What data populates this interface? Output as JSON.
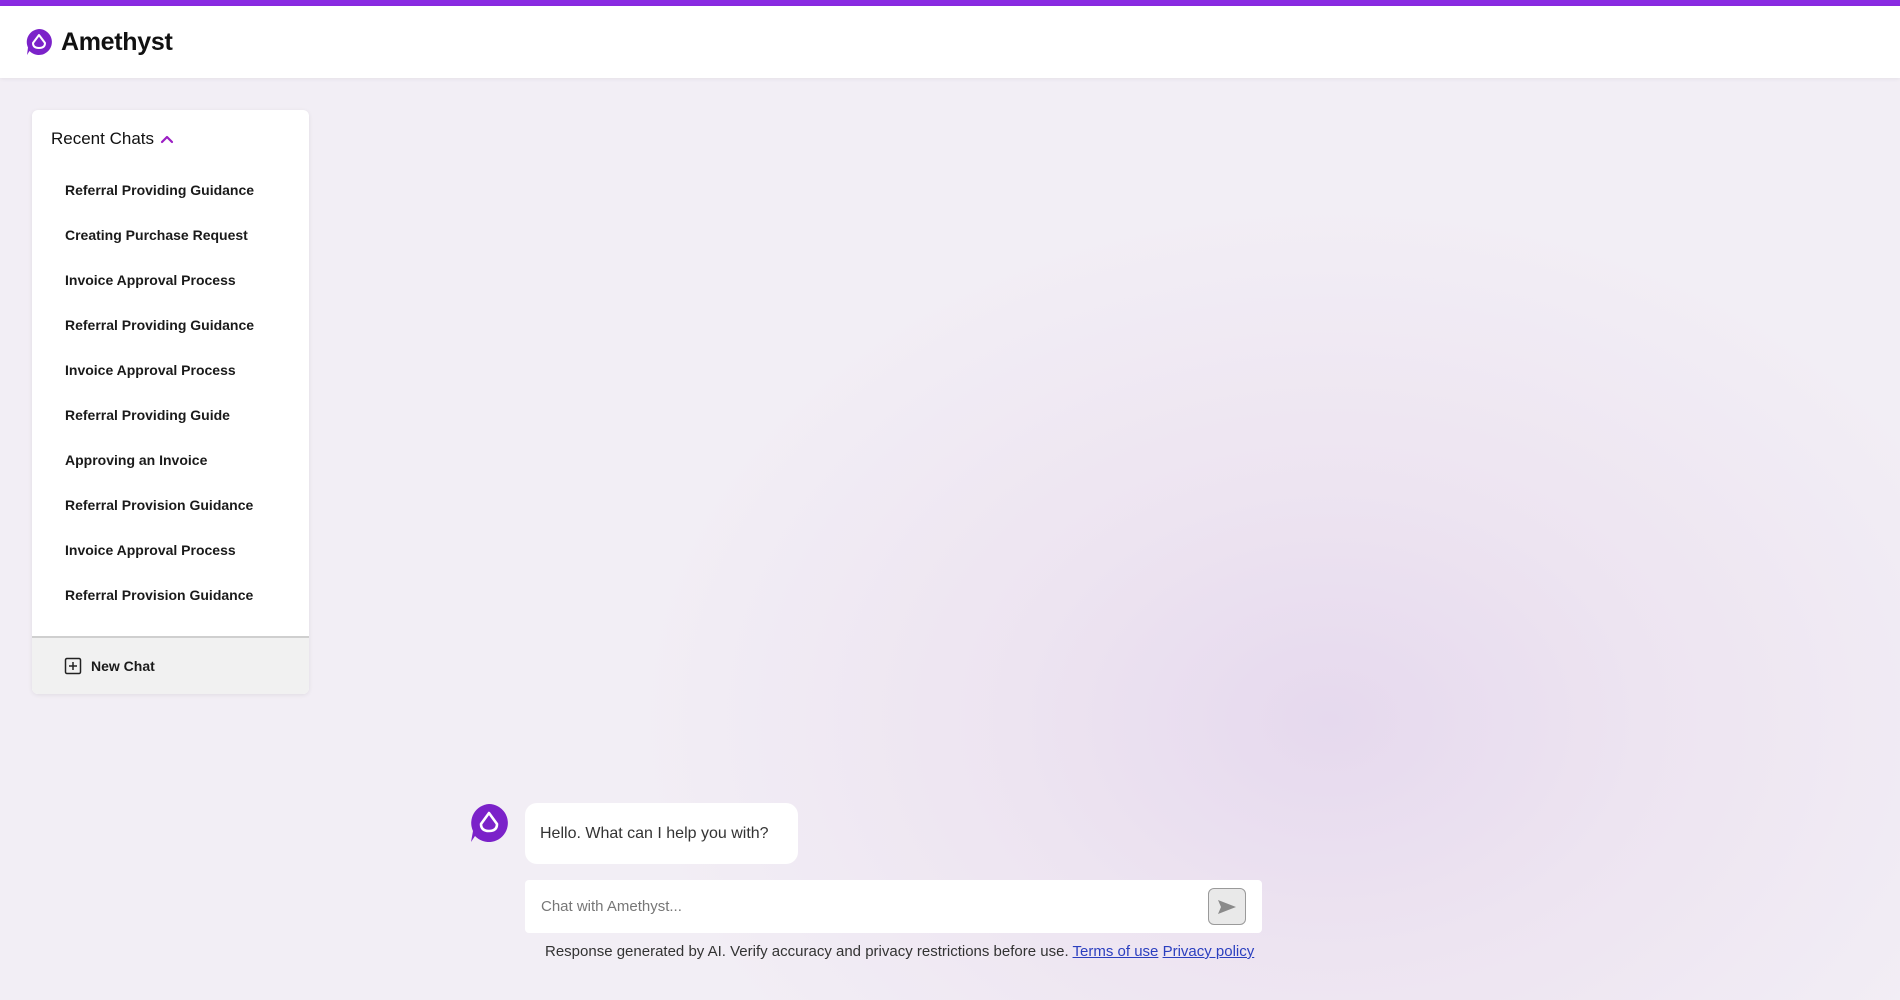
{
  "app": {
    "name": "Amethyst",
    "accent_color": "#8a2be2",
    "logo_icon": "amethyst-logo-icon"
  },
  "sidebar": {
    "title": "Recent Chats",
    "toggle_icon": "chevron-up-icon",
    "chats": [
      {
        "label": "Referral Providing Guidance"
      },
      {
        "label": "Creating Purchase Request"
      },
      {
        "label": "Invoice Approval Process"
      },
      {
        "label": "Referral Providing Guidance"
      },
      {
        "label": "Invoice Approval Process"
      },
      {
        "label": "Referral Providing Guide"
      },
      {
        "label": "Approving an Invoice"
      },
      {
        "label": "Referral Provision Guidance"
      },
      {
        "label": "Invoice Approval Process"
      },
      {
        "label": "Referral Provision Guidance"
      }
    ],
    "new_chat_label": "New Chat",
    "new_chat_icon": "plus-square-icon"
  },
  "conversation": {
    "greeting": "Hello. What can I help you with?"
  },
  "composer": {
    "placeholder": "Chat with Amethyst...",
    "send_icon": "send-icon"
  },
  "footer": {
    "disclaimer": "Response generated by AI. Verify accuracy and privacy restrictions before use.",
    "terms_label": "Terms of use",
    "privacy_label": "Privacy policy"
  }
}
